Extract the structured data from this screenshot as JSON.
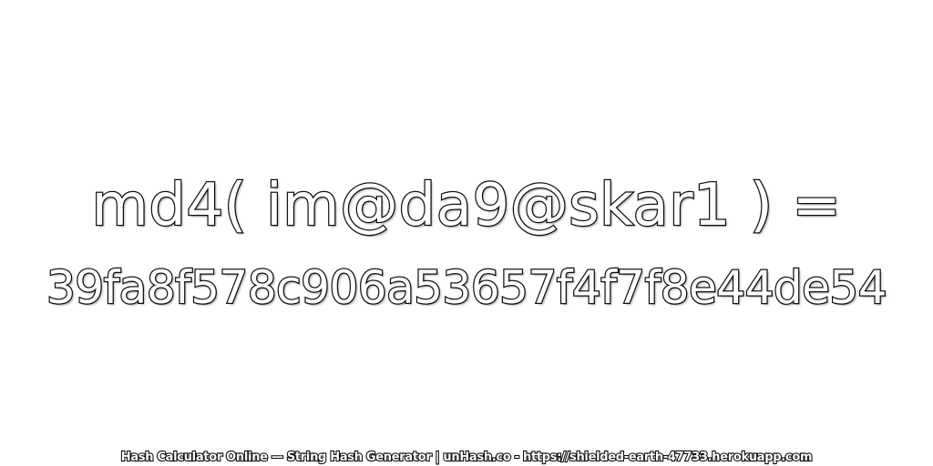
{
  "expression": "md4( im@da9@skar1 ) =",
  "hash": "39fa8f578c906a53657f4f7f8e44de54",
  "footer": "Hash Calculator Online — String Hash Generator | unHash.co - https://shielded-earth-47733.herokuapp.com",
  "colors": {
    "background": "#ffffff",
    "text_fill": "#ffffff",
    "text_outline": "#111111"
  }
}
